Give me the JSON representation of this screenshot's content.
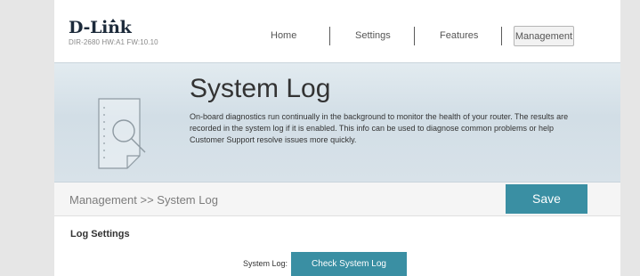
{
  "header": {
    "brand": "D-Link",
    "model": "DIR-2680 HW:A1 FW:10.10",
    "nav": {
      "home": "Home",
      "settings": "Settings",
      "features": "Features",
      "management": "Management"
    }
  },
  "banner": {
    "title": "System Log",
    "description": "On-board diagnostics run continually in the background to monitor the health of your router. The results are recorded in the system log if it is enabled. This info can be used to diagnose common problems or help Customer Support resolve issues more quickly.",
    "icon": "document-magnifier-icon"
  },
  "pathbar": {
    "breadcrumb": "Management >> System Log",
    "save_label": "Save"
  },
  "log_settings": {
    "section_title": "Log Settings",
    "system_log_label": "System Log:",
    "check_button_label": "Check System Log"
  },
  "colors": {
    "accent": "#3a8fa3",
    "page_background": "#e6e6e6",
    "banner_background": "#d2dee6"
  }
}
